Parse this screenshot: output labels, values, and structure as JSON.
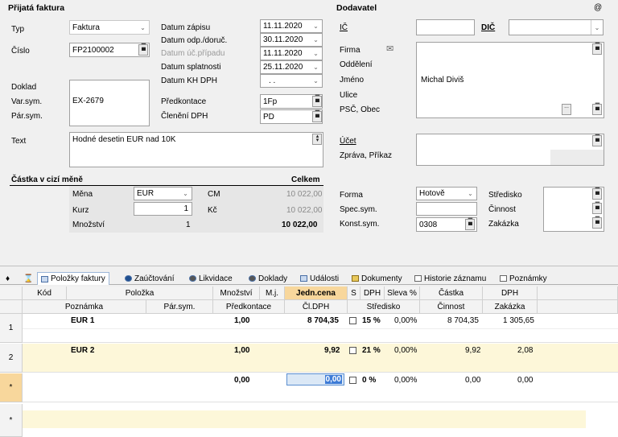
{
  "header": {
    "title": "Přijatá faktura",
    "dodavatel_title": "Dodavatel",
    "at_symbol": "@"
  },
  "left": {
    "typ_label": "Typ",
    "typ_value": "Faktura",
    "cislo_label": "Číslo",
    "cislo_value": "FP2100002",
    "doklad_label": "Doklad",
    "varsym_label": "Var.sym.",
    "varsym_value": "EX-2679",
    "parsym_label": "Pár.sym.",
    "text_label": "Text",
    "text_value": "Hodné desetin EUR nad 10K"
  },
  "dates": {
    "zapis_label": "Datum zápisu",
    "zapis_value": "11.11.2020",
    "odp_label": "Datum odp./doruč.",
    "odp_value": "30.11.2020",
    "uc_label": "Datum úč.případu",
    "uc_value": "11.11.2020",
    "splat_label": "Datum splatnosti",
    "splat_value": "25.11.2020",
    "kh_label": "Datum KH DPH",
    "kh_value": ". .",
    "predkontace_label": "Předkontace",
    "predkontace_value": "1Fp",
    "cleneni_label": "Členění DPH",
    "cleneni_value": "PD"
  },
  "currency": {
    "section_title": "Částka v cizí měně",
    "celkem_label": "Celkem",
    "mena_label": "Měna",
    "mena_value": "EUR",
    "kurz_label": "Kurz",
    "kurz_value": "1",
    "mnozstvi_label": "Množství",
    "mnozstvi_value": "1",
    "cm_label": "CM",
    "cm_value": "10 022,00",
    "kc_label": "Kč",
    "kc_value": "10 022,00",
    "total_value": "10 022,00"
  },
  "supplier": {
    "ic_label": "IČ",
    "dic_label": "DIČ",
    "firma_label": "Firma",
    "oddeleni_label": "Oddělení",
    "jmeno_label": "Jméno",
    "jmeno_value": "Michal Diviš",
    "ulice_label": "Ulice",
    "psc_label": "PSČ, Obec",
    "ucet_label": "Účet",
    "zprava_label": "Zpráva, Příkaz",
    "forma_label": "Forma",
    "forma_value": "Hotově",
    "specsym_label": "Spec.sym.",
    "konstsym_label": "Konst.sym.",
    "konstsym_value": "0308",
    "stredisko_label": "Středisko",
    "cinnost_label": "Činnost",
    "zakazka_label": "Zakázka",
    "ellipsis": "..."
  },
  "tabs": [
    {
      "label": "Položky faktury"
    },
    {
      "label": "Zaúčtování"
    },
    {
      "label": "Likvidace"
    },
    {
      "label": "Doklady"
    },
    {
      "label": "Události"
    },
    {
      "label": "Dokumenty"
    },
    {
      "label": "Historie záznamu"
    },
    {
      "label": "Poznámky"
    }
  ],
  "grid": {
    "h1": {
      "kod": "Kód",
      "polozka": "Položka",
      "mnozstvi": "Množství",
      "mj": "M.j.",
      "jedncena": "Jedn.cena",
      "s": "S",
      "dph": "DPH",
      "sleva": "Sleva %",
      "castka": "Částka",
      "dph2": "DPH"
    },
    "h2": {
      "poznamka": "Poznámka",
      "parsym": "Pár.sym.",
      "predkontace": "Předkontace",
      "cldph": "Čl.DPH",
      "stredisko": "Středisko",
      "cinnost": "Činnost",
      "zakazka": "Zakázka"
    },
    "rows": [
      {
        "num": "1",
        "polozka": "EUR 1",
        "mnozstvi": "1,00",
        "cena": "8 704,35",
        "dph": "15 %",
        "sleva": "0,00%",
        "castka": "8 704,35",
        "dph2": "1 305,65"
      },
      {
        "num": "2",
        "polozka": "EUR 2",
        "mnozstvi": "1,00",
        "cena": "9,92",
        "dph": "21 %",
        "sleva": "0,00%",
        "castka": "9,92",
        "dph2": "2,08"
      },
      {
        "num": "*",
        "polozka": "",
        "mnozstvi": "0,00",
        "cena": "0,00",
        "dph": "0 %",
        "sleva": "0,00%",
        "castka": "0,00",
        "dph2": "0,00"
      }
    ],
    "new_row_marker": "*",
    "star_marker": "*"
  }
}
